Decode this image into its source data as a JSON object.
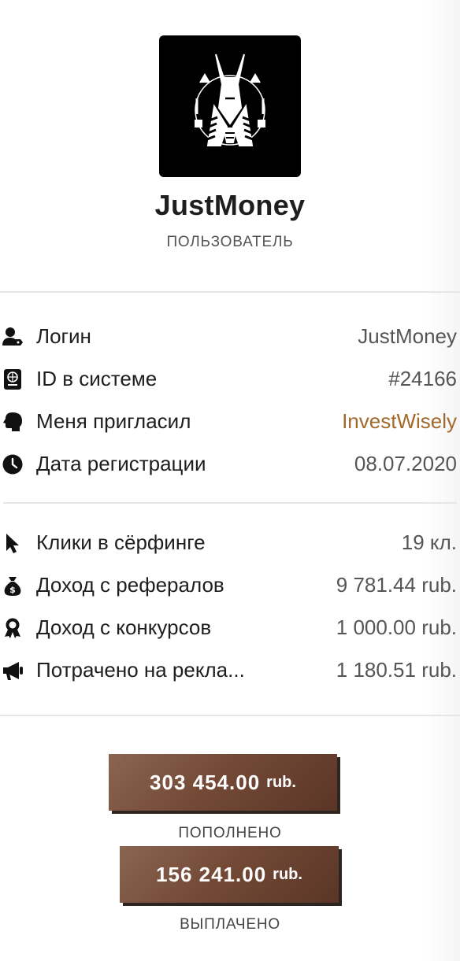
{
  "profile": {
    "username": "JustMoney",
    "role": "ПОЛЬЗОВАТЕЛЬ",
    "avatar_icon": "anubis-logo"
  },
  "account_info": [
    {
      "icon": "user-tag-icon",
      "label": "Логин",
      "value": "JustMoney",
      "is_link": false
    },
    {
      "icon": "passport-icon",
      "label": "ID в системе",
      "value": "#24166",
      "is_link": false
    },
    {
      "icon": "head-speech-icon",
      "label": "Меня пригласил",
      "value": "InvestWisely",
      "is_link": true
    },
    {
      "icon": "clock-icon",
      "label": "Дата регистрации",
      "value": "08.07.2020",
      "is_link": false
    }
  ],
  "stats": [
    {
      "icon": "cursor-icon",
      "label": "Клики в сёрфинге",
      "value": "19 кл."
    },
    {
      "icon": "money-bag-icon",
      "label": "Доход с рефералов",
      "value": "9 781.44 rub."
    },
    {
      "icon": "award-icon",
      "label": "Доход с конкурсов",
      "value": "1 000.00 rub."
    },
    {
      "icon": "megaphone-icon",
      "label": "Потрачено на рекла...",
      "value": "1 180.51 rub."
    }
  ],
  "totals": {
    "deposited": {
      "amount": "303 454.00",
      "currency": "rub.",
      "caption": "ПОПОЛНЕНО"
    },
    "withdrawn": {
      "amount": "156 241.00",
      "currency": "rub.",
      "caption": "ВЫПЛАЧЕНО"
    }
  },
  "colors": {
    "accent_link": "#a3692a",
    "button_brown": "#744a37",
    "button_shadow": "#2e2420"
  }
}
